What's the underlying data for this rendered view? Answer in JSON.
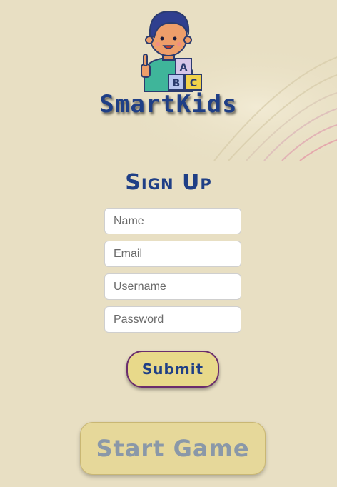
{
  "brand": {
    "logo_icon": "kid-with-abc-blocks-icon",
    "name": "SmartKids",
    "blocks": [
      "A",
      "B",
      "C"
    ]
  },
  "signup": {
    "title": "Sign Up",
    "fields": {
      "name_placeholder": "Name",
      "email_placeholder": "Email",
      "username_placeholder": "Username",
      "password_placeholder": "Password"
    },
    "submit_label": "Submit"
  },
  "start_game_label": "Start Game",
  "colors": {
    "background": "#e8dfc3",
    "brand_blue": "#1f3f86",
    "button_yellow": "#e8d98a",
    "submit_border": "#6a2d6d",
    "start_text": "#8a98a8"
  }
}
